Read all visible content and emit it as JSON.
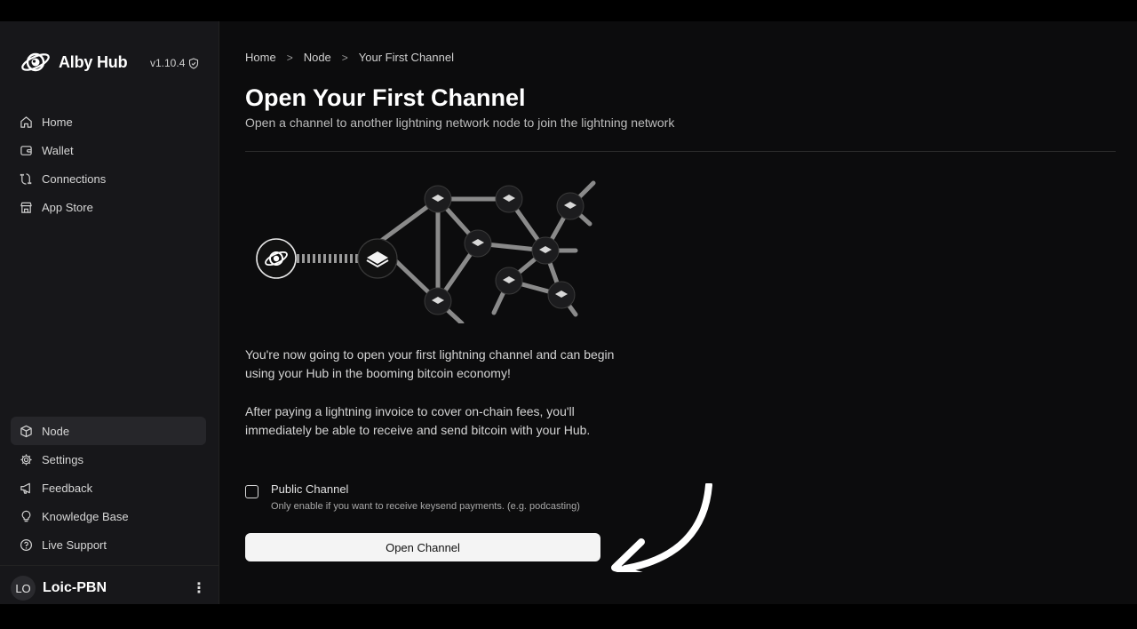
{
  "app": {
    "name": "Alby Hub",
    "version": "v1.10.4"
  },
  "sidebar": {
    "top_items": [
      {
        "label": "Home",
        "icon": "home-icon"
      },
      {
        "label": "Wallet",
        "icon": "wallet-icon"
      },
      {
        "label": "Connections",
        "icon": "connections-icon"
      },
      {
        "label": "App Store",
        "icon": "store-icon"
      }
    ],
    "bottom_items": [
      {
        "label": "Node",
        "icon": "box-icon",
        "active": true
      },
      {
        "label": "Settings",
        "icon": "gear-icon"
      },
      {
        "label": "Feedback",
        "icon": "megaphone-icon"
      },
      {
        "label": "Knowledge Base",
        "icon": "lightbulb-icon"
      },
      {
        "label": "Live Support",
        "icon": "help-circle-icon"
      }
    ],
    "user": {
      "initials": "LO",
      "name": "Loic-PBN"
    }
  },
  "breadcrumb": [
    "Home",
    "Node",
    "Your First Channel"
  ],
  "page": {
    "title": "Open Your First Channel",
    "subtitle": "Open a channel to another lightning network node to join the lightning network",
    "paragraph1": "You're now going to open your first lightning channel and can begin using your Hub in the booming bitcoin economy!",
    "paragraph2": "After paying a lightning invoice to cover on-chain fees, you'll immediately be able to receive and send bitcoin with your Hub.",
    "public_channel": {
      "label": "Public Channel",
      "help": "Only enable if you want to receive keysend payments. (e.g. podcasting)",
      "checked": false
    },
    "open_button": "Open Channel"
  },
  "colors": {
    "background": "#0c0c0d",
    "sidebar": "#17171a",
    "button": "#f4f4f4",
    "accent_text": "#ffffff"
  }
}
